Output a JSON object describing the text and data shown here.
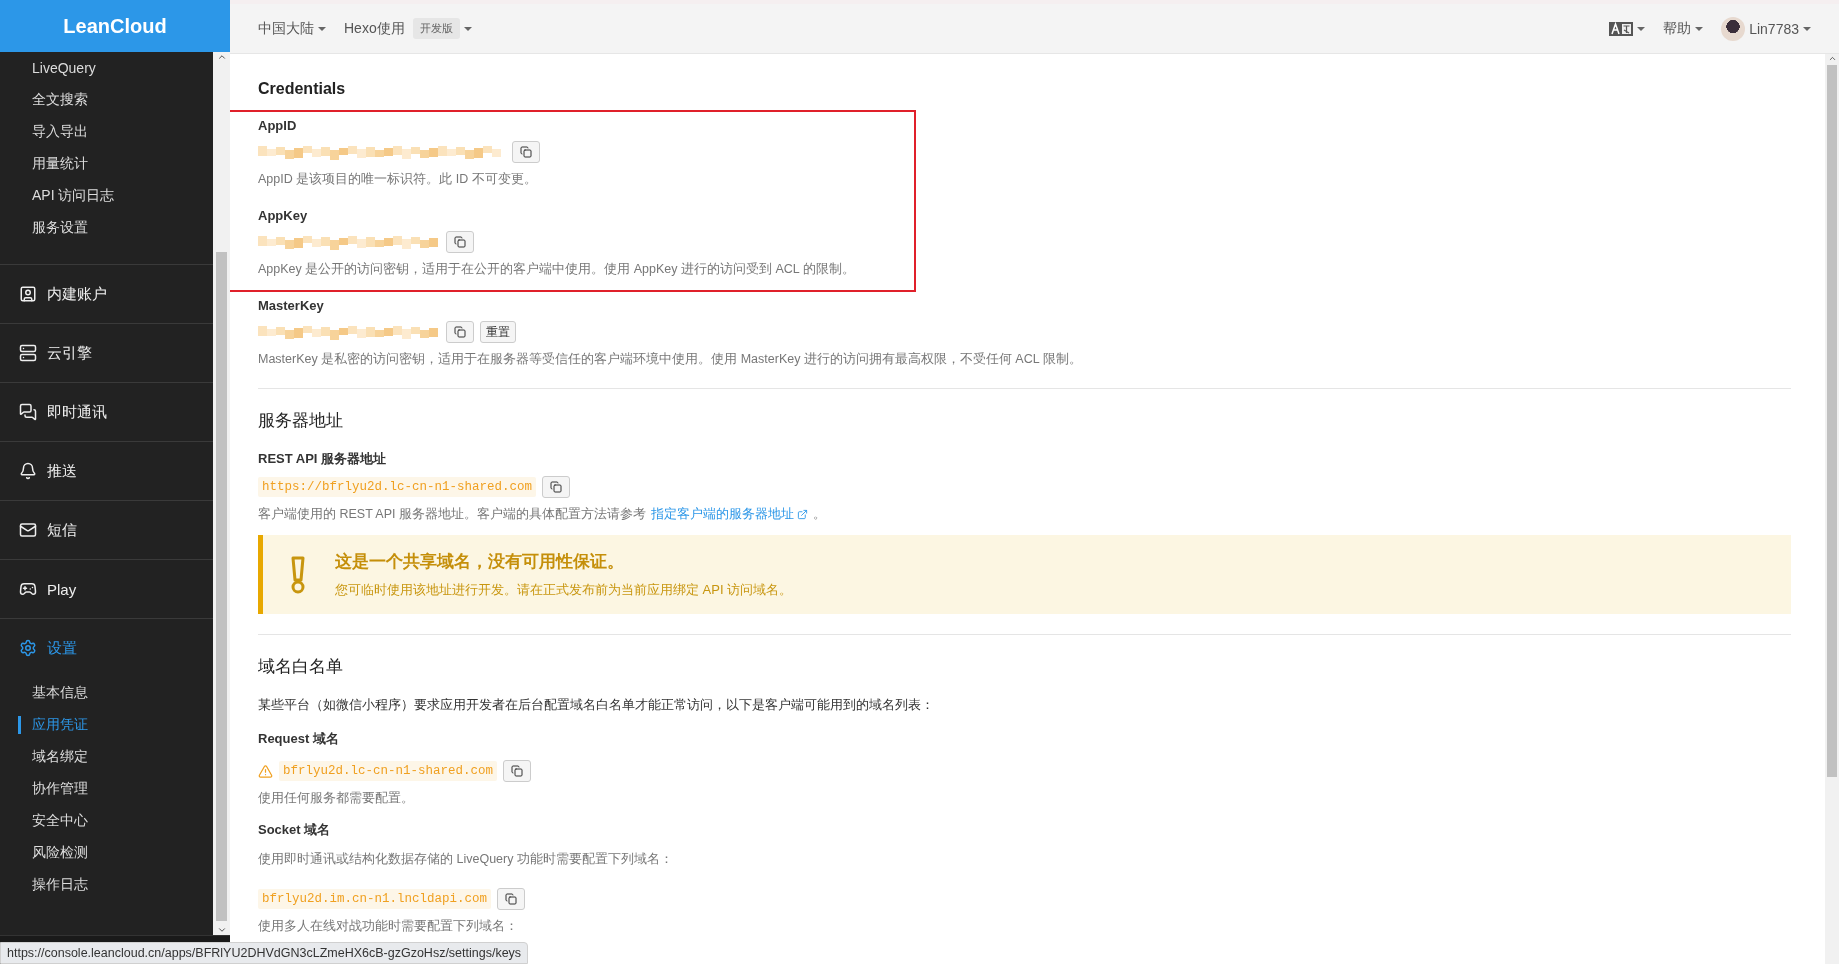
{
  "sidebar": {
    "logo": "LeanCloud",
    "top_items": [
      {
        "label": "LiveQuery"
      },
      {
        "label": "全文搜索"
      },
      {
        "label": "导入导出"
      },
      {
        "label": "用量统计"
      },
      {
        "label": "API 访问日志"
      },
      {
        "label": "服务设置"
      }
    ],
    "sections": [
      {
        "label": "内建账户",
        "selected": false
      },
      {
        "label": "云引擎",
        "selected": false
      },
      {
        "label": "即时通讯",
        "selected": false
      },
      {
        "label": "推送",
        "selected": false
      },
      {
        "label": "短信",
        "selected": false
      },
      {
        "label": "Play",
        "selected": false
      },
      {
        "label": "设置",
        "selected": true,
        "children": [
          {
            "label": "基本信息",
            "selected": false
          },
          {
            "label": "应用凭证",
            "selected": true
          },
          {
            "label": "域名绑定",
            "selected": false
          },
          {
            "label": "协作管理",
            "selected": false
          },
          {
            "label": "安全中心",
            "selected": false
          },
          {
            "label": "风险检测",
            "selected": false
          },
          {
            "label": "操作日志",
            "selected": false
          }
        ]
      }
    ]
  },
  "topbar": {
    "region": "中国大陆",
    "app": "Hexo使用",
    "app_badge": "开发版",
    "help": "帮助",
    "user": "Lin7783"
  },
  "credentials": {
    "title": "Credentials",
    "fields": [
      {
        "label": "AppID",
        "description": "AppID 是该项目的唯一标识符。此 ID 不可变更。"
      },
      {
        "label": "AppKey",
        "description": "AppKey 是公开的访问密钥，适用于在公开的客户端中使用。使用 AppKey 进行的访问受到 ACL 的限制。"
      },
      {
        "label": "MasterKey",
        "reset_button": "重置",
        "description": "MasterKey 是私密的访问密钥，适用于在服务器等受信任的客户端环境中使用。使用 MasterKey 进行的访问拥有最高权限，不受任何 ACL 限制。"
      }
    ]
  },
  "server": {
    "title": "服务器地址",
    "label": "REST API 服务器地址",
    "url": "https://bfrlyu2d.lc-cn-n1-shared.com",
    "description": "客户端使用的 REST API 服务器地址。客户端的具体配置方法请参考",
    "link": "指定客户端的服务器地址",
    "suffix": "。",
    "warning": {
      "title": "这是一个共享域名，没有可用性保证。",
      "text": "您可临时使用该地址进行开发。请在正式发布前为当前应用绑定 API 访问域名。"
    }
  },
  "whitelist": {
    "title": "域名白名单",
    "intro": "某些平台（如微信小程序）要求应用开发者在后台配置域名白名单才能正常访问，以下是客户端可能用到的域名列表：",
    "groups": [
      {
        "label": "Request 域名",
        "warning": true,
        "domain": "bfrlyu2d.lc-cn-n1-shared.com",
        "note": "使用任何服务都需要配置。"
      },
      {
        "label": "Socket 域名",
        "warning": false,
        "intro": "使用即时通讯或结构化数据存储的 LiveQuery 功能时需要配置下列域名：",
        "domain": "bfrlyu2d.im.cn-n1.lncldapi.com",
        "note": "使用多人在线对战功能时需要配置下列域名："
      }
    ]
  },
  "status_bar": {
    "url": "https://console.leancloud.cn/apps/BFRlYU2DHVdGN3cLZmeHX6cB-gzGzoHsz/settings/keys"
  }
}
